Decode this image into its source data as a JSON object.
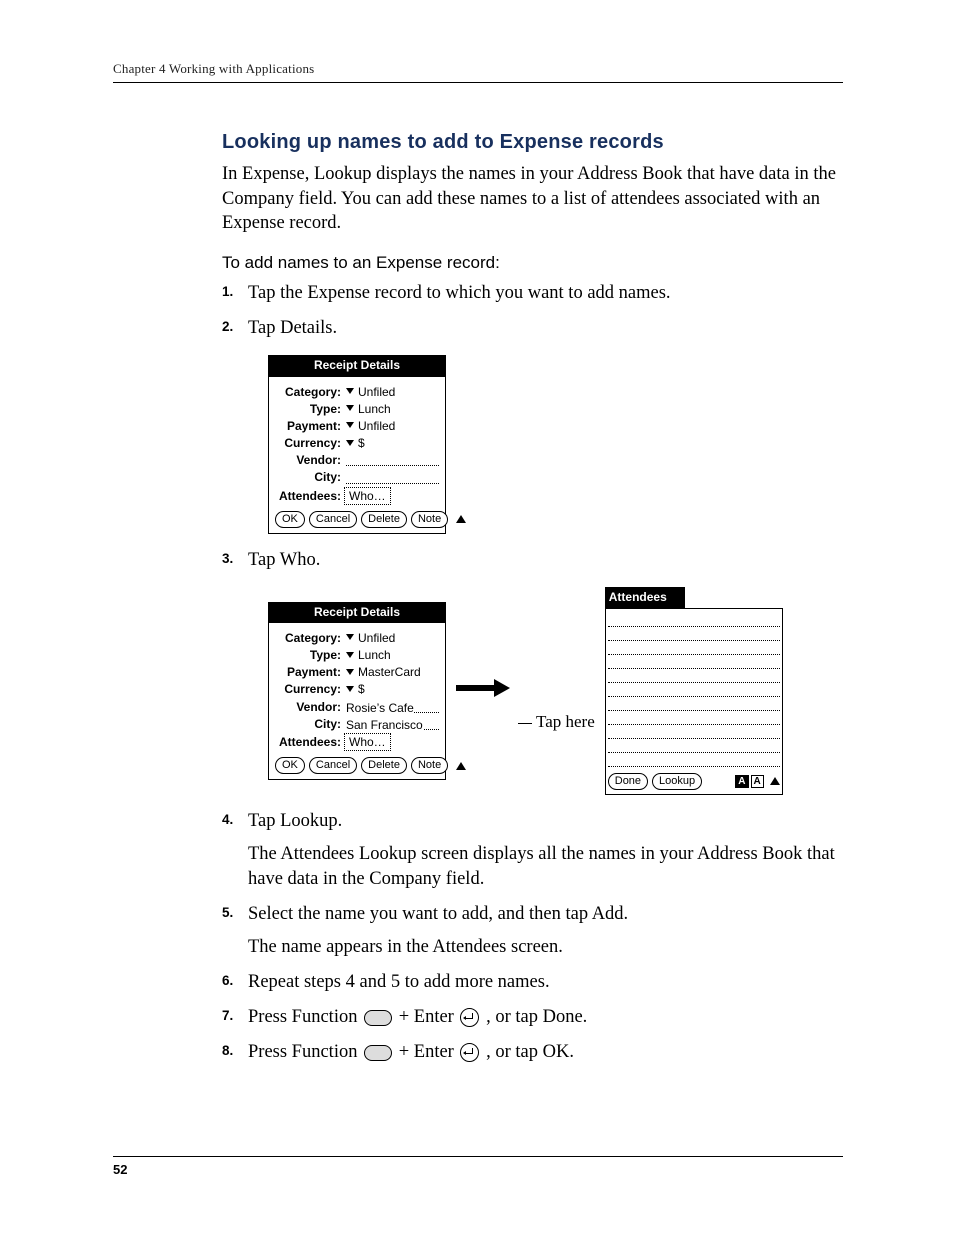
{
  "header": {
    "text": "Chapter 4   Working with Applications"
  },
  "section": {
    "title": "Looking up names to add to Expense records",
    "intro": "In Expense, Lookup displays the names in your Address Book that have data in the Company field. You can add these names to a list of attendees associated with an Expense record.",
    "procTitle": "To add names to an Expense record:"
  },
  "steps": {
    "s1": "Tap the Expense record to which you want to add names.",
    "s2": "Tap Details.",
    "s3": "Tap Who.",
    "s4": "Tap Lookup.",
    "s4b": "The Attendees Lookup screen displays all the names in your Address Book that have data in the Company field.",
    "s5": "Select the name you want to add, and then tap Add.",
    "s5b": "The name appears in the Attendees screen.",
    "s6": "Repeat steps 4 and 5 to add more names.",
    "s7a": "Press Function ",
    "s7b": " + Enter ",
    "s7c": " , or tap Done.",
    "s8a": "Press Function ",
    "s8b": " + Enter ",
    "s8c": " , or tap OK."
  },
  "nums": {
    "n1": "1.",
    "n2": "2.",
    "n3": "3.",
    "n4": "4.",
    "n5": "5.",
    "n6": "6.",
    "n7": "7.",
    "n8": "8."
  },
  "palm": {
    "title": "Receipt Details",
    "labels": {
      "category": "Category:",
      "type": "Type:",
      "payment": "Payment:",
      "currency": "Currency:",
      "vendor": "Vendor:",
      "city": "City:",
      "attendees": "Attendees:"
    },
    "buttons": {
      "ok": "OK",
      "cancel": "Cancel",
      "delete": "Delete",
      "note": "Note"
    }
  },
  "fig1": {
    "category": "Unfiled",
    "type": "Lunch",
    "payment": "Unfiled",
    "currency": "$",
    "vendor": "",
    "city": "",
    "who": "Who…"
  },
  "fig2": {
    "category": "Unfiled",
    "type": "Lunch",
    "payment": "MasterCard",
    "currency": "$",
    "vendor": "Rosie’s Cafe",
    "city": "San Francisco",
    "who": "Who…",
    "tapHere": "Tap here"
  },
  "attendees": {
    "title": "Attendees",
    "done": "Done",
    "lookup": "Lookup",
    "A": "A"
  },
  "footer": {
    "page": "52"
  },
  "chart_data": null
}
